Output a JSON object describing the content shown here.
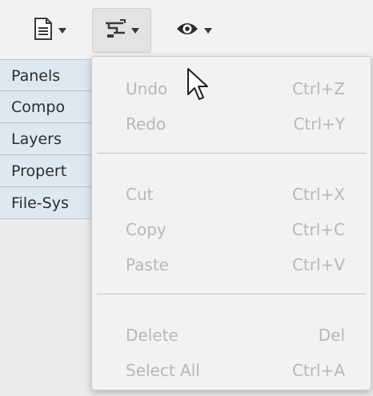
{
  "toolbar": {
    "buttons": [
      {
        "icon": "document-icon"
      },
      {
        "icon": "edit-icon"
      },
      {
        "icon": "eye-icon"
      }
    ]
  },
  "side_panel": {
    "items": [
      {
        "label": "Panels"
      },
      {
        "label": "Compo"
      },
      {
        "label": "Layers"
      },
      {
        "label": "Propert"
      },
      {
        "label": "File-Sys"
      }
    ]
  },
  "edit_menu": {
    "items": [
      {
        "label": "Undo",
        "shortcut": "Ctrl+Z"
      },
      {
        "label": "Redo",
        "shortcut": "Ctrl+Y"
      },
      {
        "label": "Cut",
        "shortcut": "Ctrl+X"
      },
      {
        "label": "Copy",
        "shortcut": "Ctrl+C"
      },
      {
        "label": "Paste",
        "shortcut": "Ctrl+V"
      },
      {
        "label": "Delete",
        "shortcut": "Del"
      },
      {
        "label": "Select All",
        "shortcut": "Ctrl+A"
      }
    ]
  }
}
